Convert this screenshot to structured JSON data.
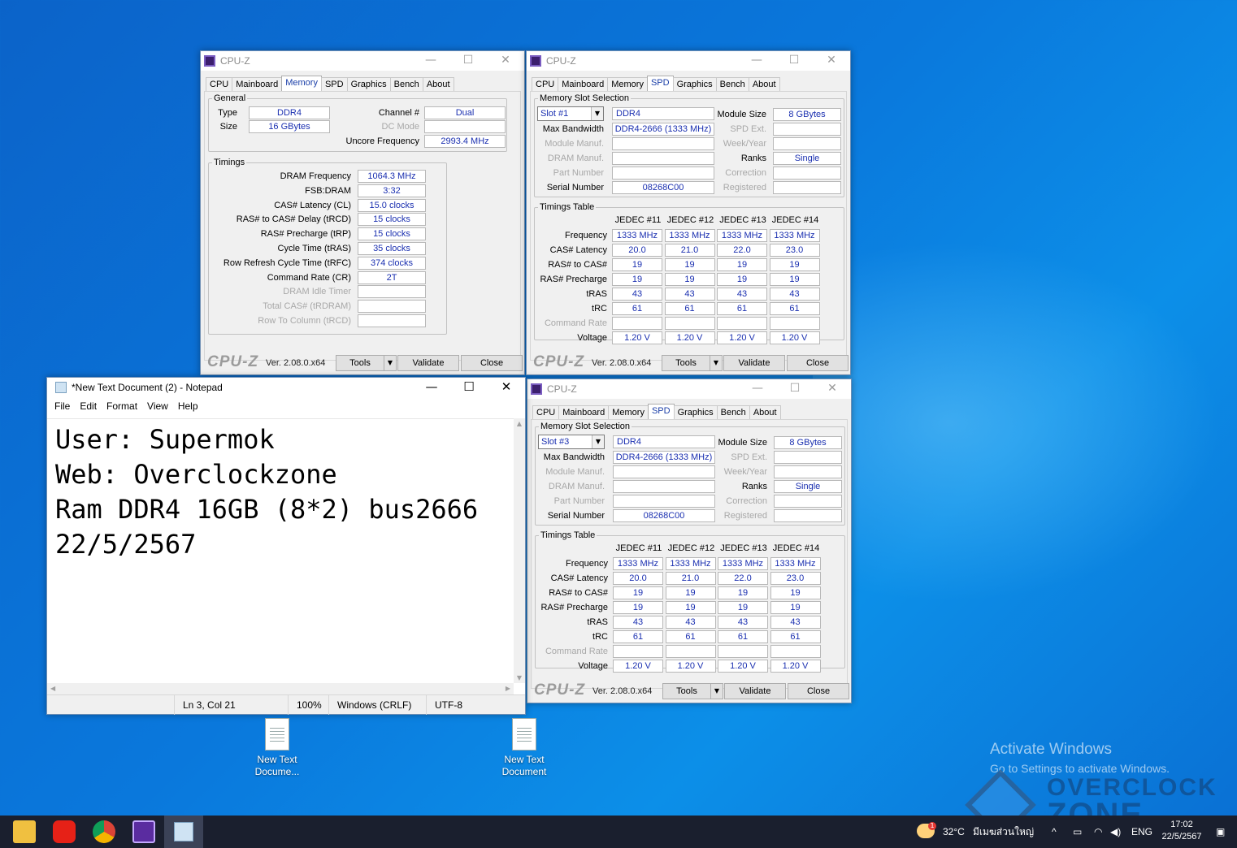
{
  "cpuz_common": {
    "title": "CPU-Z",
    "tabs": [
      "CPU",
      "Mainboard",
      "Memory",
      "SPD",
      "Graphics",
      "Bench",
      "About"
    ],
    "logo": "CPU-Z",
    "version": "Ver. 2.08.0.x64",
    "tools": "Tools",
    "validate": "Validate",
    "close": "Close",
    "minimize": "—",
    "maximize": "☐",
    "close_x": "✕"
  },
  "memory": {
    "general_legend": "General",
    "type_label": "Type",
    "type_value": "DDR4",
    "size_label": "Size",
    "size_value": "16 GBytes",
    "channel_label": "Channel #",
    "channel_value": "Dual",
    "dcmode_label": "DC Mode",
    "dcmode_value": "",
    "uncore_label": "Uncore Frequency",
    "uncore_value": "2993.4 MHz",
    "timings_legend": "Timings",
    "timings": [
      {
        "label": "DRAM Frequency",
        "value": "1064.3 MHz",
        "dim": false
      },
      {
        "label": "FSB:DRAM",
        "value": "3:32",
        "dim": false
      },
      {
        "label": "CAS# Latency (CL)",
        "value": "15.0 clocks",
        "dim": false
      },
      {
        "label": "RAS# to CAS# Delay (tRCD)",
        "value": "15 clocks",
        "dim": false
      },
      {
        "label": "RAS# Precharge (tRP)",
        "value": "15 clocks",
        "dim": false
      },
      {
        "label": "Cycle Time (tRAS)",
        "value": "35 clocks",
        "dim": false
      },
      {
        "label": "Row Refresh Cycle Time (tRFC)",
        "value": "374 clocks",
        "dim": false
      },
      {
        "label": "Command Rate (CR)",
        "value": "2T",
        "dim": false
      },
      {
        "label": "DRAM Idle Timer",
        "value": "",
        "dim": true
      },
      {
        "label": "Total CAS# (tRDRAM)",
        "value": "",
        "dim": true
      },
      {
        "label": "Row To Column (tRCD)",
        "value": "",
        "dim": true
      }
    ]
  },
  "spd_labels": {
    "slot_legend": "Memory Slot Selection",
    "max_bw": "Max Bandwidth",
    "module_manuf": "Module Manuf.",
    "dram_manuf": "DRAM Manuf.",
    "part_number": "Part Number",
    "serial_number": "Serial Number",
    "module_size": "Module Size",
    "spd_ext": "SPD Ext.",
    "week_year": "Week/Year",
    "ranks": "Ranks",
    "correction": "Correction",
    "registered": "Registered",
    "timings_legend": "Timings Table",
    "jedec": [
      "JEDEC #11",
      "JEDEC #12",
      "JEDEC #13",
      "JEDEC #14"
    ],
    "rows": [
      {
        "label": "Frequency",
        "values": [
          "1333 MHz",
          "1333 MHz",
          "1333 MHz",
          "1333 MHz"
        ],
        "dim": false
      },
      {
        "label": "CAS# Latency",
        "values": [
          "20.0",
          "21.0",
          "22.0",
          "23.0"
        ],
        "dim": false
      },
      {
        "label": "RAS# to CAS#",
        "values": [
          "19",
          "19",
          "19",
          "19"
        ],
        "dim": false
      },
      {
        "label": "RAS# Precharge",
        "values": [
          "19",
          "19",
          "19",
          "19"
        ],
        "dim": false
      },
      {
        "label": "tRAS",
        "values": [
          "43",
          "43",
          "43",
          "43"
        ],
        "dim": false
      },
      {
        "label": "tRC",
        "values": [
          "61",
          "61",
          "61",
          "61"
        ],
        "dim": false
      },
      {
        "label": "Command Rate",
        "values": [
          "",
          "",
          "",
          ""
        ],
        "dim": true
      },
      {
        "label": "Voltage",
        "values": [
          "1.20 V",
          "1.20 V",
          "1.20 V",
          "1.20 V"
        ],
        "dim": false
      }
    ]
  },
  "spd1": {
    "slot": "Slot #1",
    "type": "DDR4",
    "bandwidth": "DDR4-2666 (1333 MHz)",
    "serial": "08268C00",
    "size": "8 GBytes",
    "ranks": "Single"
  },
  "spd3": {
    "slot": "Slot #3",
    "type": "DDR4",
    "bandwidth": "DDR4-2666 (1333 MHz)",
    "serial": "08268C00",
    "size": "8 GBytes",
    "ranks": "Single"
  },
  "notepad": {
    "title": "*New Text Document (2) - Notepad",
    "menu": [
      "File",
      "Edit",
      "Format",
      "View",
      "Help"
    ],
    "lines": [
      "User: Supermok",
      "Web: Overclockzone",
      "Ram DDR4 16GB (8*2) bus2666",
      "22/5/2567"
    ],
    "status_pos": "Ln 3, Col 21",
    "status_zoom": "100%",
    "status_eol": "Windows (CRLF)",
    "status_enc": "UTF-8"
  },
  "desktop": {
    "icon1": "New Text Docume...",
    "icon2": "New Text Document",
    "activate_title": "Activate Windows",
    "activate_sub": "Go to Settings to activate Windows.",
    "watermark1": "OVERCLOCK",
    "watermark2": "ZONE"
  },
  "taskbar": {
    "weather_temp": "32°C",
    "weather_text": "มีเมฆส่วนใหญ่",
    "lang": "ENG",
    "time": "17:02",
    "date": "22/5/2567",
    "notif_badge": "1"
  }
}
